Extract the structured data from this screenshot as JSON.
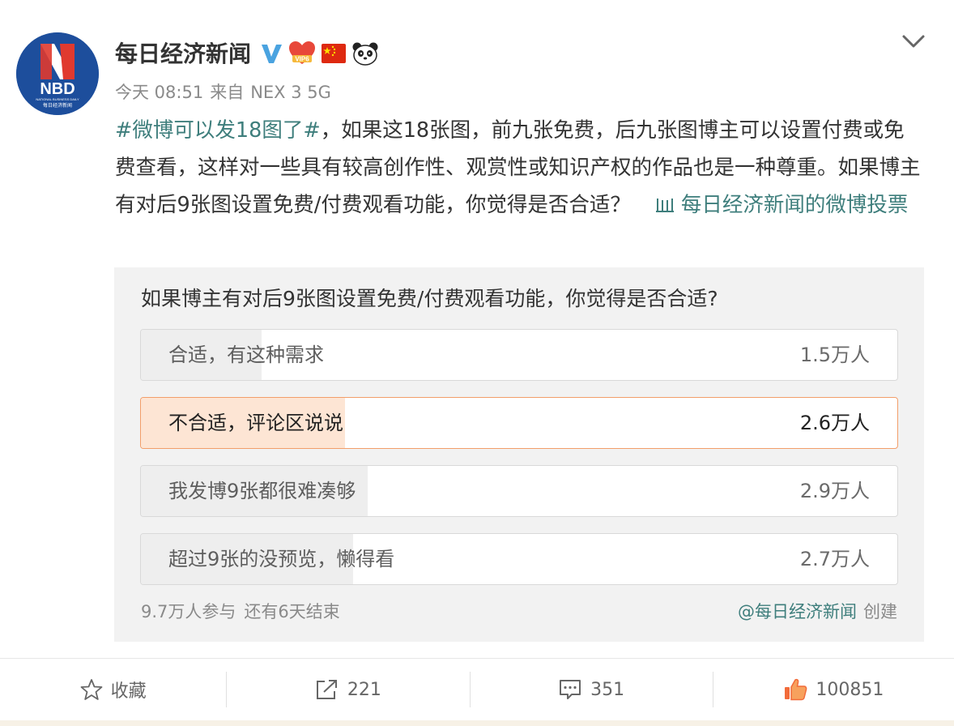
{
  "post": {
    "author": {
      "name": "每日经济新闻",
      "avatar_text": "NBD",
      "avatar_subtext": "每日经济新闻",
      "avatar_tagline": "NATIONAL BUSINESS DAILY",
      "verified_icon": "verified-v-icon",
      "badges": [
        "vip6-heart-badge",
        "china-flag-badge",
        "panda-badge"
      ],
      "badge_vip_text": "VIP6"
    },
    "time": "今天 08:51",
    "source_prefix": "来自",
    "source": "NEX 3 5G",
    "menu_icon": "chevron-down-icon",
    "text": {
      "topic": "#微博可以发18图了#",
      "body": "，如果这18张图，前九张免费，后九张图博主可以设置付费或免费查看，这样对一些具有较高创作性、观赏性或知识产权的作品也是一种尊重。如果博主有对后9张图设置免费/付费观看功能，你觉得是否合适？",
      "vote_link": "每日经济新闻的微博投票",
      "vote_icon": "poll-icon"
    }
  },
  "poll": {
    "question": "如果博主有对后9张图设置免费/付费观看功能，你觉得是否合适?",
    "options": [
      {
        "label": "合适，有这种需求",
        "count": "1.5万人",
        "share": 0.16,
        "selected": false
      },
      {
        "label": "不合适，评论区说说",
        "count": "2.6万人",
        "share": 0.27,
        "selected": true
      },
      {
        "label": "我发博9张都很难凑够",
        "count": "2.9万人",
        "share": 0.3,
        "selected": false
      },
      {
        "label": "超过9张的没预览，懒得看",
        "count": "2.7万人",
        "share": 0.28,
        "selected": false
      }
    ],
    "participants": "9.7万人参与",
    "remaining": "还有6天结束",
    "creator": "@每日经济新闻",
    "created_label": "创建"
  },
  "actions": {
    "favorite": {
      "label": "收藏",
      "icon": "star-icon"
    },
    "repost": {
      "count": "221",
      "icon": "share-icon"
    },
    "comment": {
      "count": "351",
      "icon": "comment-icon"
    },
    "like": {
      "count": "100851",
      "icon": "thumbs-up-icon"
    }
  },
  "colors": {
    "link": "#3e7e7c",
    "selected_border": "#f29e6a",
    "selected_fill": "#fde5d4",
    "poll_bg": "#f2f2f2",
    "verified_blue": "#4aa3e0",
    "like_orange": "#f26b3a"
  }
}
